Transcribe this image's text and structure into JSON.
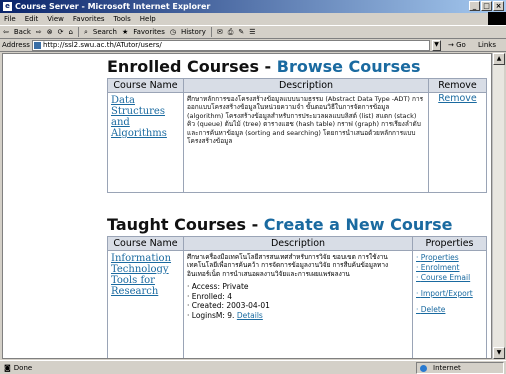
{
  "window": {
    "title": "Course Server - Microsoft Internet Explorer"
  },
  "menu": [
    "File",
    "Edit",
    "View",
    "Favorites",
    "Tools",
    "Help"
  ],
  "toolbar": {
    "back": "Back",
    "search": "Search",
    "favorites": "Favorites",
    "history": "History"
  },
  "address": {
    "label": "Address",
    "url": "http://ssl2.swu.ac.th/ATutor/users/",
    "go": "Go",
    "links": "Links"
  },
  "enrolled": {
    "heading": "Enrolled Courses - ",
    "heading_link": "Browse Courses",
    "columns": [
      "Course Name",
      "Description",
      "Remove"
    ],
    "course_name": "Data Structures and Algorithms",
    "description": "ศึกษาหลักการของโครงสร้างข้อมูลแบบนามธรรม (Abstract Data Type -ADT) การออกแบบโครงสร้างข้อมูลในหน่วยความจำ ขั้นตอนวิธีในการจัดการข้อมูล (algorithm) โครงสร้างข้อมูลสำหรับการประมวลผลแบบลิสต์ (list) สแตก (stack) คิว (queue) ต้นไม้ (tree) ตารางแฮช (hash table) กราฟ (graph) การเรียงลำดับและการค้นหาข้อมูล (sorting and searching) โดยการนำเสนอด้วยหลักการแบบโครงสร้างข้อมูล",
    "remove": "Remove"
  },
  "taught": {
    "heading": "Taught Courses - ",
    "heading_link": "Create a New Course",
    "columns": [
      "Course Name",
      "Description",
      "Properties"
    ],
    "course_name": "Information Technology Tools for Research",
    "description": "ศึกษาเครื่องมือเทคโนโลยีสารสนเทศสำหรับการวิจัย ขอบเขต การใช้งานเทคโนโลยีเพื่อการค้นคว้า การจัดการข้อมูลงานวิจัย การสืบค้นข้อมูลทางอินเทอร์เน็ต การนำเสนอผลงานวิจัยและการเผยแพร่ผลงาน",
    "access": "· Access: Private",
    "enrolled": "· Enrolled: 4",
    "created": "· Created: 2003-04-01",
    "logins": "· LoginsM: 9.",
    "details": "Details",
    "properties": [
      "Properties",
      "Enrolment",
      "Course Email",
      "Import/Export",
      "Delete"
    ]
  },
  "status": {
    "text": "Done",
    "zone": "Internet"
  }
}
